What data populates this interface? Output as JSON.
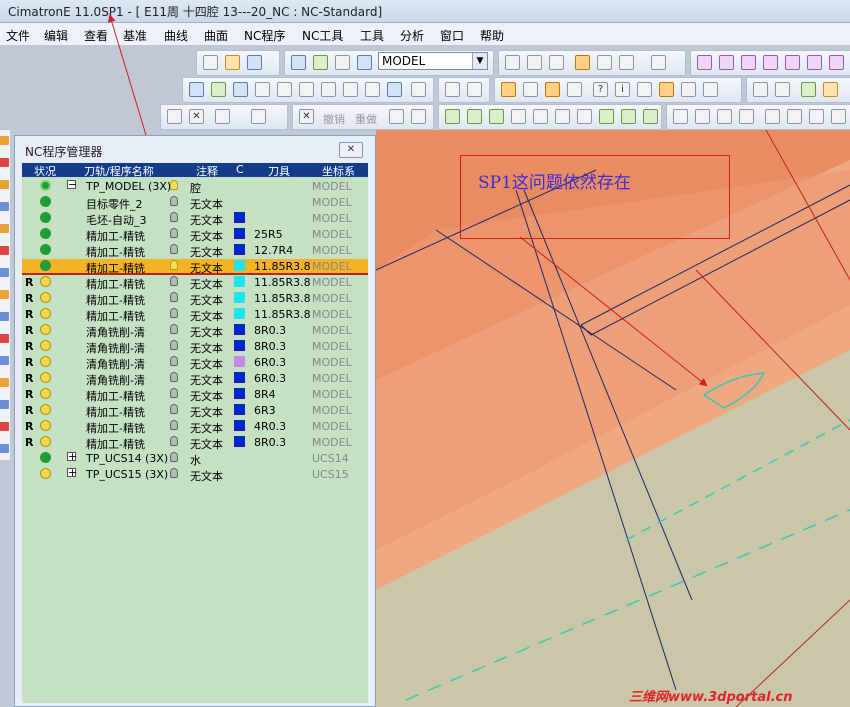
{
  "window": {
    "title": "CimatronE 11.0SP1 - [ E11周 十四腔 13---20_NC : NC-Standard]"
  },
  "menu": [
    "文件",
    "编辑",
    "查看",
    "基准",
    "曲线",
    "曲面",
    "NC程序",
    "NC工具",
    "工具",
    "分析",
    "窗口",
    "帮助"
  ],
  "toolbar": {
    "model_select": "MODEL",
    "undo_label": "撤销",
    "redo_label": "重做"
  },
  "panel": {
    "title": "NC程序管理器",
    "columns": [
      "状况",
      "刀轨/程序名称",
      "注释",
      "C",
      "刀具",
      "坐标系"
    ],
    "rows": [
      {
        "flag": "",
        "status": "go",
        "name": "TP_MODEL (3X)",
        "expander": "−",
        "note": "腔",
        "color": "",
        "tool": "",
        "cs": "MODEL"
      },
      {
        "flag": "",
        "status": "check",
        "name": "目标零件_2",
        "expander": "",
        "note": "无文本",
        "color": "",
        "tool": "",
        "cs": "MODEL"
      },
      {
        "flag": "",
        "status": "check",
        "name": "毛坯-自动_3",
        "expander": "",
        "note": "无文本",
        "color": "#0a23c9",
        "tool": "",
        "cs": "MODEL"
      },
      {
        "flag": "",
        "status": "check",
        "name": "精加工-精铣",
        "expander": "",
        "note": "无文本",
        "color": "#0a23c9",
        "tool": "25R5",
        "cs": "MODEL"
      },
      {
        "flag": "",
        "status": "check",
        "name": "精加工-精铣",
        "expander": "",
        "note": "无文本",
        "color": "#0a23c9",
        "tool": "12.7R4",
        "cs": "MODEL"
      },
      {
        "flag": "",
        "status": "check",
        "name": "精加工-精铣",
        "expander": "",
        "note": "无文本",
        "color": "#21e3ee",
        "tool": "11.85R3.8",
        "cs": "MODEL",
        "selected": true
      },
      {
        "flag": "R",
        "status": "bulb",
        "name": "精加工-精铣",
        "expander": "",
        "note": "无文本",
        "color": "#21e3ee",
        "tool": "11.85R3.8",
        "cs": "MODEL"
      },
      {
        "flag": "R",
        "status": "bulb",
        "name": "精加工-精铣",
        "expander": "",
        "note": "无文本",
        "color": "#21e3ee",
        "tool": "11.85R3.8",
        "cs": "MODEL"
      },
      {
        "flag": "R",
        "status": "bulb",
        "name": "精加工-精铣",
        "expander": "",
        "note": "无文本",
        "color": "#21e3ee",
        "tool": "11.85R3.8",
        "cs": "MODEL"
      },
      {
        "flag": "R",
        "status": "bulb",
        "name": "清角铣削-清",
        "expander": "",
        "note": "无文本",
        "color": "#0a23c9",
        "tool": "8R0.3",
        "cs": "MODEL"
      },
      {
        "flag": "R",
        "status": "bulb",
        "name": "清角铣削-清",
        "expander": "",
        "note": "无文本",
        "color": "#0a23c9",
        "tool": "8R0.3",
        "cs": "MODEL"
      },
      {
        "flag": "R",
        "status": "bulb",
        "name": "清角铣削-清",
        "expander": "",
        "note": "无文本",
        "color": "#c58ae6",
        "tool": "6R0.3",
        "cs": "MODEL"
      },
      {
        "flag": "R",
        "status": "bulb",
        "name": "清角铣削-清",
        "expander": "",
        "note": "无文本",
        "color": "#0a23c9",
        "tool": "6R0.3",
        "cs": "MODEL"
      },
      {
        "flag": "R",
        "status": "bulb",
        "name": "精加工-精铣",
        "expander": "",
        "note": "无文本",
        "color": "#0a23c9",
        "tool": "8R4",
        "cs": "MODEL"
      },
      {
        "flag": "R",
        "status": "bulb",
        "name": "精加工-精铣",
        "expander": "",
        "note": "无文本",
        "color": "#0a23c9",
        "tool": "6R3",
        "cs": "MODEL"
      },
      {
        "flag": "R",
        "status": "bulb",
        "name": "精加工-精铣",
        "expander": "",
        "note": "无文本",
        "color": "#0a23c9",
        "tool": "4R0.3",
        "cs": "MODEL"
      },
      {
        "flag": "R",
        "status": "bulb",
        "name": "精加工-精铣",
        "expander": "",
        "note": "无文本",
        "color": "#0a23c9",
        "tool": "8R0.3",
        "cs": "MODEL"
      },
      {
        "flag": "",
        "status": "check",
        "name": "TP_UCS14 (3X)",
        "expander": "+",
        "note": "水",
        "color": "",
        "tool": "",
        "cs": "UCS14"
      },
      {
        "flag": "",
        "status": "bulb",
        "name": "TP_UCS15 (3X)",
        "expander": "+",
        "note": "无文本",
        "color": "",
        "tool": "",
        "cs": "UCS15"
      }
    ]
  },
  "annotation": {
    "text": "SP1这问题依然存在"
  },
  "watermark": "三维网www.3dportal.cn"
}
